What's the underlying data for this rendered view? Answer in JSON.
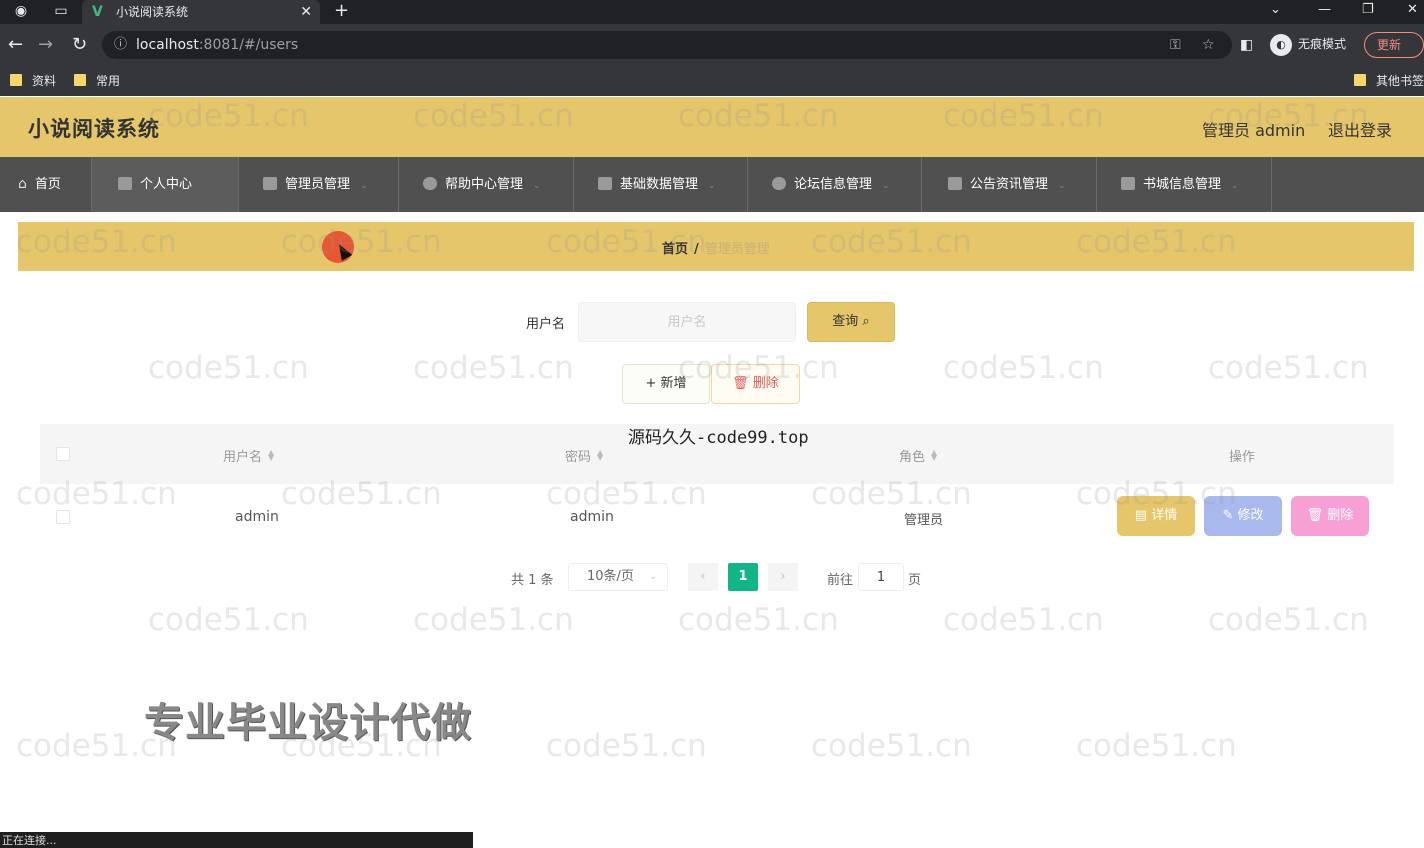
{
  "browser": {
    "tab_title": "小说阅读系统",
    "close_glyph": "✕",
    "newtab_glyph": "+",
    "url_host": "localhost",
    "url_rest": ":8081/#/users",
    "incognito_label": "无痕模式",
    "update_label": "更新",
    "bookmarks": [
      "资料",
      "常用"
    ],
    "other_bookmarks": "其他书签"
  },
  "header": {
    "title": "小说阅读系统",
    "admin": "管理员 admin",
    "logout": "退出登录"
  },
  "nav": {
    "items": [
      {
        "label": "首页"
      },
      {
        "label": "个人中心"
      },
      {
        "label": "管理员管理"
      },
      {
        "label": "帮助中心管理"
      },
      {
        "label": "基础数据管理"
      },
      {
        "label": "论坛信息管理"
      },
      {
        "label": "公告资讯管理"
      },
      {
        "label": "书城信息管理"
      }
    ]
  },
  "breadcrumb": {
    "home": "首页",
    "sep": "/",
    "current": "管理员管理"
  },
  "search": {
    "label": "用户名",
    "placeholder": "用户名",
    "query_label": "查询 ⌕"
  },
  "actions": {
    "add_label": "+ 新增",
    "delete_label": "🗑 删除"
  },
  "overlay_text": "源码久久-code99.top",
  "table": {
    "headers": {
      "username": "用户名",
      "password": "密码",
      "role": "角色",
      "ops": "操作"
    },
    "rows": [
      {
        "username": "admin",
        "password": "admin",
        "role": "管理员"
      }
    ],
    "row_buttons": {
      "detail": "▤ 详情",
      "edit": "✎ 修改",
      "delete": "🗑 删除"
    }
  },
  "pagination": {
    "total": "共 1 条",
    "page_size": "10条/页",
    "prev": "‹",
    "next": "›",
    "current_page": "1",
    "goto_label": "前往",
    "goto_value": "1",
    "page_suffix": "页"
  },
  "promo": "专业毕业设计代做",
  "watermark": "code51.cn",
  "status": "正在连接..."
}
